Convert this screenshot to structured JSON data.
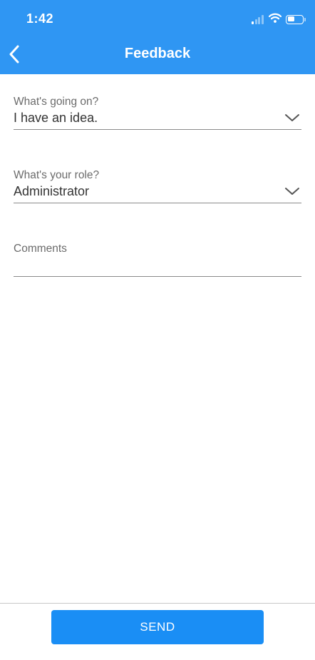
{
  "status_bar": {
    "time": "1:42",
    "icons": [
      "cellular-signal-icon",
      "wifi-icon",
      "battery-icon"
    ]
  },
  "nav": {
    "title": "Feedback",
    "back_icon": "chevron-left-icon"
  },
  "form": {
    "going_on": {
      "label": "What's going on?",
      "value": "I have an idea.",
      "icon": "chevron-down-icon"
    },
    "role": {
      "label": "What's your role?",
      "value": "Administrator",
      "icon": "chevron-down-icon"
    },
    "comments": {
      "label": "Comments",
      "value": ""
    }
  },
  "footer": {
    "send_label": "SEND"
  },
  "colors": {
    "header": "#2f96f3",
    "send_button": "#1a8ef5",
    "label": "#6b6b6b",
    "value": "#333333",
    "underline": "#8a8a8a"
  }
}
